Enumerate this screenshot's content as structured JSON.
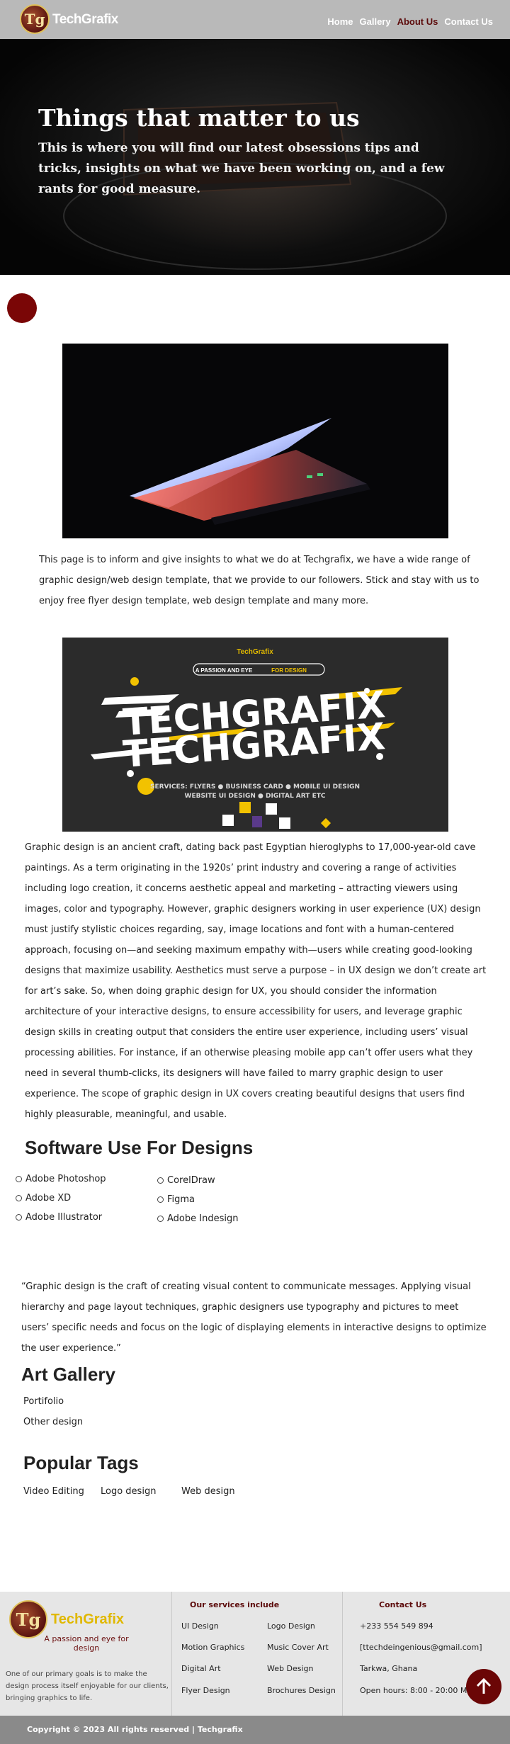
{
  "nav": {
    "logo_mark": "Tg",
    "logo_text": "TechGrafix",
    "links": [
      "Home",
      "Gallery",
      "About Us",
      "Contact Us"
    ],
    "active": "About Us"
  },
  "hero": {
    "title": "Things that matter to us",
    "subtitle": "This is where you will find our latest obsessions tips and tricks, insights on what we have been working on, and a few rants for good measure."
  },
  "intro_paragraph": "This page is to inform and give insights to what we do at Techgrafix, we have a wide range of graphic design/web design template, that we provide to our followers. Stick and stay with us to enjoy free flyer design template, web design template and many more.",
  "banner": {
    "brand": "TechGrafix",
    "pill_text_white": "A PASSION AND EYE",
    "pill_text_yellow": "FOR DESIGN",
    "headline": "TECHGRAFIX",
    "services_line1": "SERVICES:  FLYERS ● BUSINESS CARD ● MOBILE UI DESIGN",
    "services_line2": "WEBSITE UI DESIGN ● DIGITAL ART  ETC"
  },
  "about_paragraph": "Graphic design is an ancient craft, dating back past Egyptian hieroglyphs to 17,000-year-old cave paintings.  As a term originating in the 1920s’ print industry and covering a range of activities including logo creation, it concerns aesthetic appeal and marketing – attracting viewers using images, color and typography. However, graphic designers working in user experience (UX) design must justify stylistic choices regarding, say, image locations and font with a human-centered approach, focusing on—and seeking maximum empathy with—users while creating good-looking designs that maximize usability. Aesthetics must serve a purpose – in UX design we don’t create art for art’s sake. So, when doing graphic design for UX, you should consider the information architecture of your interactive designs, to ensure accessibility for users, and leverage graphic design skills in creating output that considers the entire user experience, including users’ visual processing abilities. For instance, if an otherwise pleasing mobile app can’t offer users what they need in several thumb-clicks, its designers will have failed to marry graphic design to user experience. The scope of graphic design in UX covers creating beautiful designs that users find highly pleasurable, meaningful, and usable.",
  "software": {
    "heading": "Software Use For Designs",
    "col1": [
      "Adobe Photoshop",
      "Adobe XD",
      "Adobe Illustrator"
    ],
    "col2": [
      "CorelDraw",
      "Figma",
      "Adobe Indesign"
    ]
  },
  "quote": "“Graphic design is the craft of creating visual content to communicate messages. Applying visual hierarchy and page layout techniques, graphic designers use typography and pictures to meet users’ specific needs and focus on the logic of displaying elements in interactive designs to optimize the user experience.”",
  "gallery": {
    "heading": "Art Gallery",
    "links": [
      "Portifolio",
      "Other design"
    ]
  },
  "tags": {
    "heading": "Popular Tags",
    "items": [
      "Video Editing",
      "Logo design",
      "Web design"
    ]
  },
  "footer": {
    "logo_mark": "Tg",
    "logo_text": "TechGrafix",
    "logo_tagline": "A passion and eye for design",
    "about": "One of our primary goals is to make the design process itself enjoyable for our clients, bringing graphics to life.",
    "services_heading": "Our services include",
    "services_col1": [
      "UI Design",
      "Motion Graphics",
      "Digital Art",
      "Flyer Design"
    ],
    "services_col2": [
      "Logo Design",
      "Music Cover Art",
      "Web Design",
      "Brochures Design"
    ],
    "contact_heading": "Contact Us",
    "contact": [
      "+233 554 549 894",
      "[ttechdeingenious@gmail.com]",
      "Tarkwa, Ghana",
      "Open hours: 8:00 - 20:00 Mon- Sat"
    ],
    "copyright": "Copyright © 2023 All rights reserved | Techgrafix"
  },
  "colors": {
    "brand_maroon": "#5c0b0b",
    "accent_yellow": "#e0b800",
    "nav_bg": "#b9b9b9",
    "footer_bg": "#e6e6e6"
  },
  "icons": {
    "scroll_top": "arrow-up-icon"
  }
}
